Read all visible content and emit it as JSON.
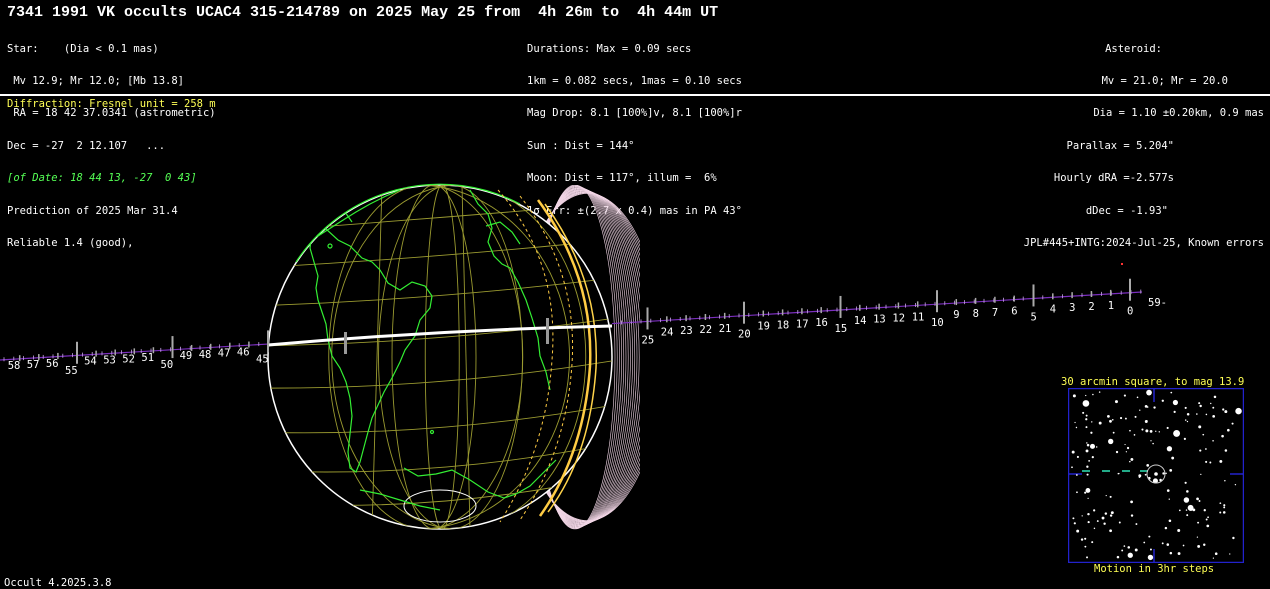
{
  "header": {
    "title": "7341 1991 VK occults UCAC4 315-214789 on 2025 May 25 from  4h 26m to  4h 44m UT"
  },
  "star_block": {
    "lines": [
      "Star:    (Dia < 0.1 mas)",
      " Mv 12.9; Mr 12.0; [Mb 13.8]",
      " RA = 18 42 37.0341 (astrometric)",
      "Dec = -27  2 12.107   ...",
      "[of Date: 18 44 13, -27  0 43]",
      "Prediction of 2025 Mar 31.4",
      "Reliable 1.4 (good),"
    ]
  },
  "event_block": {
    "lines": [
      "Durations: Max = 0.09 secs",
      "1km = 0.082 secs, 1mas = 0.10 secs",
      "Mag Drop: 8.1 [100%]v, 8.1 [100%]r",
      "Sun : Dist = 144°",
      "Moon: Dist = 117°, illum =  6%",
      "1σ Err: ±(2.7 x 0.4) mas in PA 43°"
    ]
  },
  "asteroid_block": {
    "lines": [
      "Asteroid:",
      "Mv = 21.0; Mr = 20.0",
      "Dia = 1.10 ±0.20km, 0.9 mas",
      "Parallax = 5.204\"",
      "Hourly dRA =-2.577s",
      "dDec = -1.93\"",
      "JPL#445+INTG:2024-Jul-25, Known errors"
    ]
  },
  "diffraction_label": "Diffraction: Fresnel unit = 258 m",
  "track": {
    "labels_right": [
      "0",
      "1",
      "2",
      "3",
      "4",
      "5",
      "6",
      "7",
      "8",
      "9",
      "10",
      "11",
      "12",
      "13",
      "14",
      "15",
      "16",
      "17",
      "18",
      "19",
      "20",
      "21",
      "22",
      "23",
      "24",
      "25"
    ],
    "label_59": "59-",
    "labels_left": [
      "45",
      "46",
      "47",
      "48",
      "49",
      "50",
      "51",
      "52",
      "53",
      "54",
      "55",
      "56",
      "57",
      "58"
    ]
  },
  "starchart": {
    "title": "30 arcmin square, to mag 13.9",
    "caption": "Motion in 3hr steps"
  },
  "footer": {
    "version": "Occult 4.2025.3.8"
  },
  "colors": {
    "background": "#000000",
    "text": "#ffffff",
    "highlight": "#ffff55",
    "coastline": "#33ee33",
    "graticule": "#9a9a30",
    "track": "#7b2fbf",
    "chart_frame": "#2222cc"
  }
}
